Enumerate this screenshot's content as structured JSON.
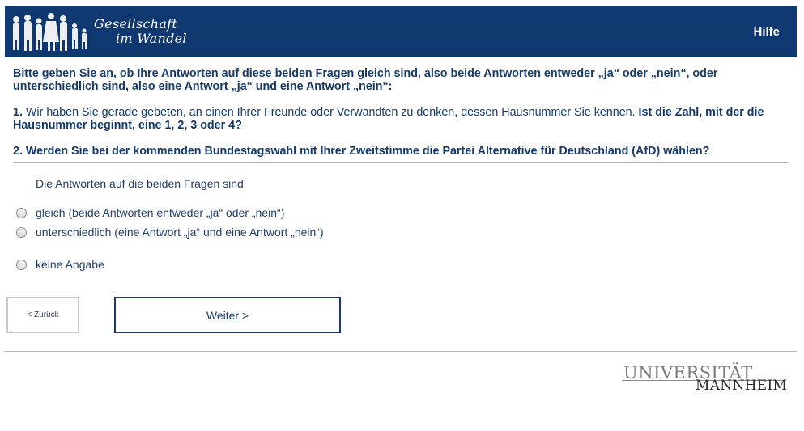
{
  "header": {
    "logo_line1": "Gesellschaft",
    "logo_line2": "im Wandel",
    "help_label": "Hilfe",
    "bg_color": "#0f3870"
  },
  "question": {
    "intro": "Bitte geben Sie an, ob Ihre Antworten auf diese beiden Fragen gleich sind, also beide Antworten entweder „ja“ oder „nein“, oder unterschiedlich sind, also eine Antwort „ja“ und eine Antwort „nein“:",
    "q1_number": "1.",
    "q1_text": " Wir haben Sie gerade gebeten, an einen Ihrer Freunde oder Verwandten zu denken, dessen Hausnummer Sie kennen. ",
    "q1_bold": "Ist die Zahl, mit der die Hausnummer beginnt, eine 1, 2, 3 oder 4?",
    "q2_text": "2. Werden Sie bei der kommenden Bundestagswahl mit Ihrer Zweitstimme die Partei Alternative für Deutschland (AfD) wählen?",
    "answer_label": "Die Antworten auf die beiden Fragen sind"
  },
  "options": [
    {
      "label": "gleich (beide Antworten entweder „ja“ oder „nein“)",
      "selected": false
    },
    {
      "label": "unterschiedlich (eine Antwort „ja“ und eine Antwort „nein“)",
      "selected": false
    },
    {
      "label": "keine Angabe",
      "selected": false
    }
  ],
  "nav": {
    "back_label": "< Zurück",
    "next_label": "Weiter >"
  },
  "footer": {
    "university_line1": "UNIVERSITÄT",
    "university_line2": "MANNHEIM"
  }
}
